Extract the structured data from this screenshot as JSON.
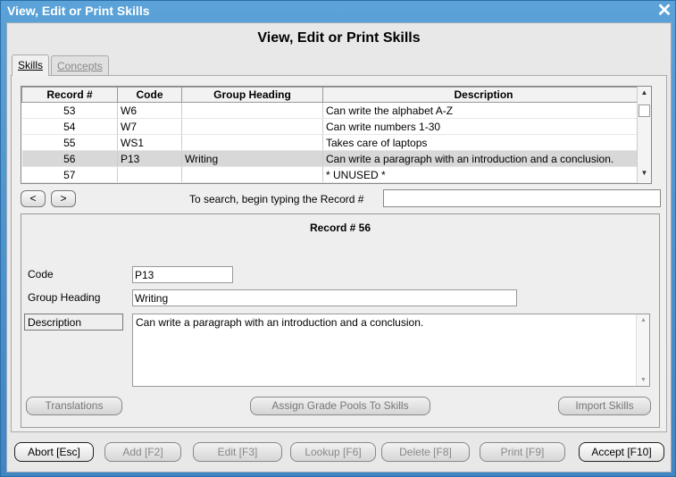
{
  "window": {
    "title": "View, Edit or Print Skills",
    "close_icon": "close-icon"
  },
  "heading": "View, Edit or Print Skills",
  "tabs": [
    {
      "label": "Skills",
      "active": true
    },
    {
      "label": "Concepts",
      "active": false
    }
  ],
  "grid": {
    "columns": [
      "Record #",
      "Code",
      "Group Heading",
      "Description"
    ],
    "rows": [
      {
        "record": "53",
        "code": "W6",
        "group": "",
        "description": "Can write the alphabet A-Z"
      },
      {
        "record": "54",
        "code": "W7",
        "group": "",
        "description": "Can write numbers 1-30"
      },
      {
        "record": "55",
        "code": "WS1",
        "group": "",
        "description": "Takes care of laptops"
      },
      {
        "record": "56",
        "code": "P13",
        "group": "Writing",
        "description": "Can write a paragraph with an introduction and a conclusion.",
        "selected": true
      },
      {
        "record": "57",
        "code": "",
        "group": "",
        "description": "* UNUSED *"
      }
    ]
  },
  "nav": {
    "prev": "<",
    "next": ">"
  },
  "search": {
    "label": "To search, begin typing the Record #",
    "value": ""
  },
  "record": {
    "title": "Record # 56",
    "code_label": "Code",
    "code_value": "P13",
    "group_label": "Group Heading",
    "group_value": "Writing",
    "desc_label": "Description",
    "desc_value": "Can write a paragraph with an introduction and a conclusion."
  },
  "panel_buttons": {
    "translations": "Translations",
    "assign": "Assign Grade Pools To Skills",
    "import": "Import Skills"
  },
  "bottom_buttons": {
    "abort": "Abort [Esc]",
    "add": "Add [F2]",
    "edit": "Edit [F3]",
    "lookup": "Lookup [F6]",
    "delete": "Delete [F8]",
    "print": "Print [F9]",
    "accept": "Accept [F10]"
  }
}
